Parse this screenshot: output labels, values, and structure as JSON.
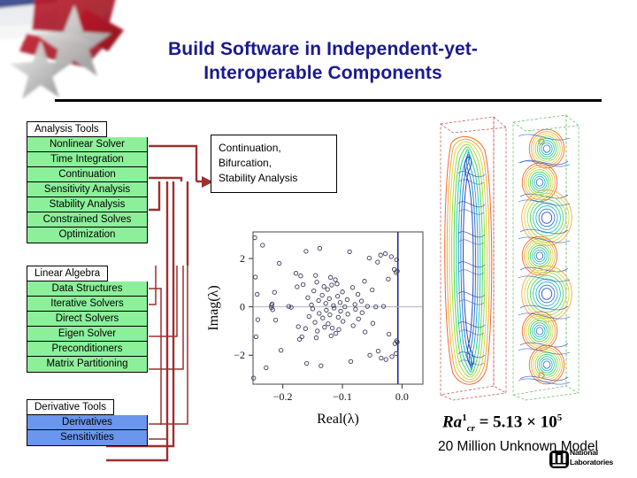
{
  "slide": {
    "title_line1": "Build Software in Independent-yet-",
    "title_line2": "Interoperable Components",
    "title_color": "#1a1a8c"
  },
  "groups": [
    {
      "id": "analysis-tools",
      "header": "Analysis Tools",
      "color": "#8cf09a",
      "items": [
        "Nonlinear Solver",
        "Time Integration",
        "Continuation",
        "Sensitivity Analysis",
        "Stability Analysis",
        "Constrained Solves",
        "Optimization"
      ]
    },
    {
      "id": "linear-algebra",
      "header": "Linear Algebra",
      "color": "#8cf09a",
      "items": [
        "Data Structures",
        "Iterative Solvers",
        "Direct Solvers",
        "Eigen Solver",
        "Preconditioners",
        "Matrix Partitioning"
      ]
    },
    {
      "id": "derivative-tools",
      "header": "Derivative Tools",
      "color": "#6b96ee",
      "items": [
        "Derivatives",
        "Sensitivities"
      ]
    }
  ],
  "callout": {
    "line1": "Continuation,",
    "line2": "Bifurcation,",
    "line3": "Stability Analysis"
  },
  "connectors": {
    "color": "#9e2f2f"
  },
  "chart_data": {
    "type": "scatter",
    "title": "",
    "xlabel": "Real(λ)",
    "ylabel": "Imag(λ)",
    "xticks": [
      "−0.2",
      "−0.1",
      "0.0"
    ],
    "xtick_values": [
      -0.2,
      -0.1,
      0.0
    ],
    "yticks": [
      "−2",
      "0",
      "2"
    ],
    "ytick_values": [
      -2,
      0,
      2
    ],
    "xlim": [
      -0.25,
      0.035
    ],
    "ylim": [
      -3.2,
      3.1
    ],
    "grid": false,
    "legend": "none",
    "marker": "open-circle",
    "marker_color": "#3b3b5c",
    "annotations": [
      {
        "type": "vline",
        "x": -0.007,
        "color": "#2222a0",
        "label": ""
      },
      {
        "type": "hline",
        "y": 0,
        "color": "#b0b0cc",
        "label": ""
      }
    ],
    "points": [
      [
        -0.247,
        2.86
      ],
      [
        -0.249,
        -2.95
      ],
      [
        -0.234,
        2.55
      ],
      [
        -0.246,
        1.23
      ],
      [
        -0.243,
        0.52
      ],
      [
        -0.242,
        -0.53
      ],
      [
        -0.245,
        -1.24
      ],
      [
        -0.228,
        -2.52
      ],
      [
        -0.219,
        0.06
      ],
      [
        -0.219,
        -0.03
      ],
      [
        -0.218,
        0.12
      ],
      [
        -0.217,
        -0.12
      ],
      [
        -0.214,
        0.6
      ],
      [
        -0.212,
        -0.55
      ],
      [
        -0.206,
        1.8
      ],
      [
        -0.203,
        -1.8
      ],
      [
        -0.19,
        0.02
      ],
      [
        -0.186,
        -0.02
      ],
      [
        -0.178,
        1.39
      ],
      [
        -0.176,
        0.83
      ],
      [
        -0.174,
        -0.82
      ],
      [
        -0.172,
        -1.34
      ],
      [
        -0.17,
        1.28
      ],
      [
        -0.168,
        -1.24
      ],
      [
        -0.166,
        0.92
      ],
      [
        -0.162,
        -0.9
      ],
      [
        -0.158,
        0.38
      ],
      [
        -0.156,
        -0.4
      ],
      [
        -0.152,
        0.08
      ],
      [
        -0.15,
        -0.08
      ],
      [
        -0.148,
        0.66
      ],
      [
        -0.146,
        -0.64
      ],
      [
        -0.143,
        1.02
      ],
      [
        -0.142,
        -1.0
      ],
      [
        -0.14,
        0.26
      ],
      [
        -0.139,
        -0.27
      ],
      [
        -0.138,
        2.42
      ],
      [
        -0.136,
        -2.44
      ],
      [
        -0.134,
        0.48
      ],
      [
        -0.133,
        -0.46
      ],
      [
        -0.131,
        0.84
      ],
      [
        -0.13,
        -0.84
      ],
      [
        -0.128,
        0.14
      ],
      [
        -0.127,
        -0.14
      ],
      [
        -0.125,
        0.72
      ],
      [
        -0.124,
        -0.7
      ],
      [
        -0.122,
        0.34
      ],
      [
        -0.121,
        -0.33
      ],
      [
        -0.118,
        0.9
      ],
      [
        -0.117,
        -0.88
      ],
      [
        -0.115,
        0.05
      ],
      [
        -0.114,
        -0.05
      ],
      [
        -0.112,
        1.12
      ],
      [
        -0.111,
        -1.1
      ],
      [
        -0.108,
        0.44
      ],
      [
        -0.107,
        -0.43
      ],
      [
        -0.104,
        0.18
      ],
      [
        -0.103,
        -0.18
      ],
      [
        -0.1,
        0.62
      ],
      [
        -0.099,
        -0.6
      ],
      [
        -0.096,
        0.0
      ],
      [
        -0.092,
        0.3
      ],
      [
        -0.091,
        -0.3
      ],
      [
        -0.088,
        2.28
      ],
      [
        -0.086,
        -2.26
      ],
      [
        -0.083,
        0.8
      ],
      [
        -0.082,
        -0.78
      ],
      [
        -0.079,
        0.1
      ],
      [
        -0.078,
        -0.1
      ],
      [
        -0.074,
        0.52
      ],
      [
        -0.073,
        -0.5
      ],
      [
        -0.068,
        0.24
      ],
      [
        -0.067,
        -0.24
      ],
      [
        -0.063,
        1.06
      ],
      [
        -0.062,
        -1.04
      ],
      [
        -0.058,
        0.02
      ],
      [
        -0.055,
        2.02
      ],
      [
        -0.054,
        -2.0
      ],
      [
        -0.05,
        0.7
      ],
      [
        -0.049,
        -0.68
      ],
      [
        -0.044,
        0.0
      ],
      [
        -0.041,
        1.85
      ],
      [
        -0.04,
        -1.83
      ],
      [
        -0.036,
        2.14
      ],
      [
        -0.035,
        -2.12
      ],
      [
        -0.031,
        0.02
      ],
      [
        -0.028,
        2.2
      ],
      [
        -0.027,
        -2.18
      ],
      [
        -0.023,
        1.15
      ],
      [
        -0.022,
        -1.13
      ],
      [
        -0.018,
        2.08
      ],
      [
        -0.017,
        -2.06
      ],
      [
        -0.013,
        1.55
      ],
      [
        -0.012,
        -1.52
      ],
      [
        -0.01,
        1.42
      ],
      [
        -0.009,
        -1.4
      ],
      [
        -0.008,
        1.48
      ],
      [
        -0.008,
        -1.46
      ],
      [
        -0.009,
        1.95
      ],
      [
        -0.01,
        -1.93
      ],
      [
        -0.109,
        0.95
      ],
      [
        -0.106,
        -0.94
      ],
      [
        -0.12,
        1.22
      ],
      [
        -0.119,
        -1.2
      ],
      [
        -0.161,
        2.3
      ],
      [
        -0.16,
        -2.34
      ],
      [
        -0.145,
        1.3
      ],
      [
        -0.144,
        -1.28
      ]
    ]
  },
  "cfd": {
    "panel_a_label": "",
    "panel_b_label": ""
  },
  "equation": {
    "symbol": "Ra",
    "superscript": "1",
    "subscript": "cr",
    "rhs": "= 5.13 × 10",
    "exponent": "5"
  },
  "caption": "20 Million Unknown Model",
  "logo": {
    "line1": "National",
    "line2": "Laboratories"
  }
}
